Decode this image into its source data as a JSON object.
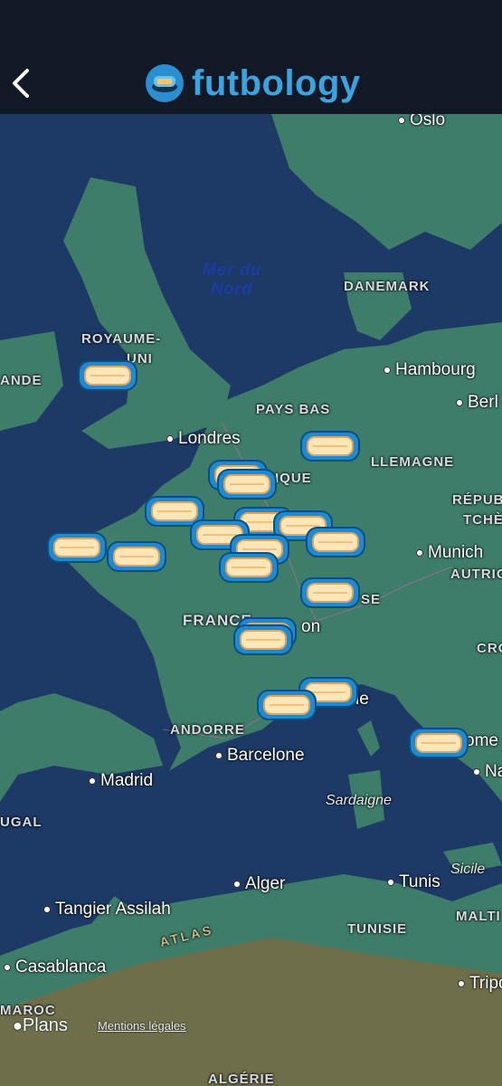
{
  "header": {
    "brand_name": "futbology",
    "back_icon": "chevron-left-icon",
    "logo_icon": "stadium-icon",
    "brand_color": "#3aa3e0"
  },
  "map": {
    "sea": {
      "line1": "Mer du",
      "line2": "Nord"
    },
    "countries": [
      "ROYAUME-",
      "UNI",
      "ANDE",
      "DANEMARK",
      "PAYS BAS",
      "LLEMAGNE",
      "IQUE",
      "RÉPUB",
      "TCHÈ",
      "AUTRIC",
      "FRANCE",
      "SE",
      "CRO",
      "ANDORRE",
      "UGAL",
      "TUNISIE",
      "MALTI",
      "MAROC",
      "ALGÉRIE"
    ],
    "cities": [
      "Oslo",
      "Hambourg",
      "Berl",
      "Londres",
      "Munich",
      "on",
      "le",
      "ome",
      "Na",
      "Barcelone",
      "Madrid",
      "Alger",
      "Tunis",
      "Tangier Assilah",
      "Casablanca",
      "Tripo"
    ],
    "islands": [
      "Sardaigne",
      "Sicile"
    ],
    "mountains": [
      "ATLAS"
    ],
    "pin_count": 19,
    "colors": {
      "sea": "#1d3a66",
      "land": "#3e7d6a",
      "desert": "#6f6e4b"
    }
  },
  "footer": {
    "attribution": "Plans",
    "legal_link": "Mentions légales"
  }
}
